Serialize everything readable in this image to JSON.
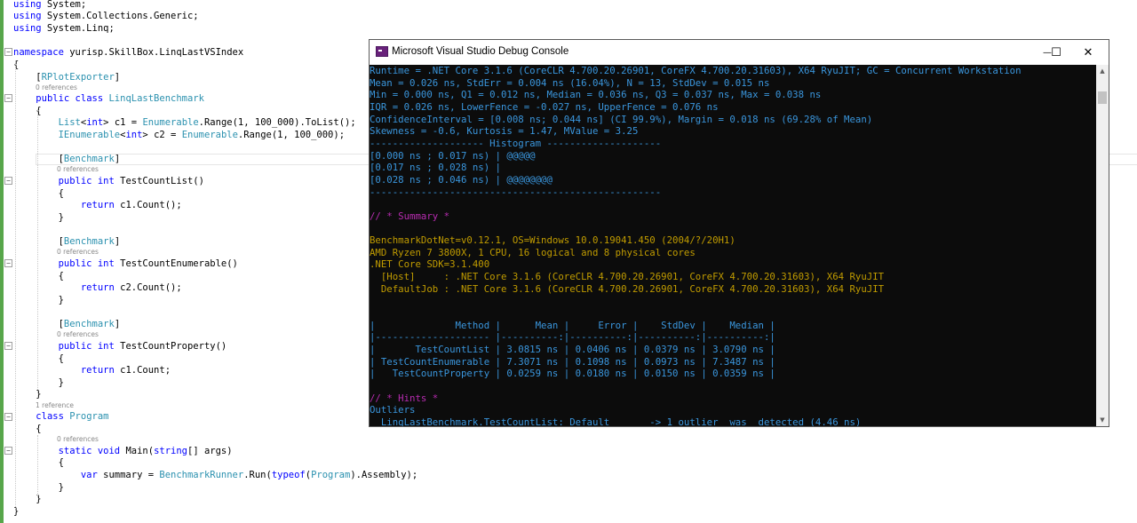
{
  "editor": {
    "lines": [
      {
        "parts": [
          [
            "kw",
            "using"
          ],
          [
            "tx",
            " System;"
          ]
        ]
      },
      {
        "parts": [
          [
            "kw",
            "using"
          ],
          [
            "tx",
            " System.Collections.Generic;"
          ]
        ]
      },
      {
        "parts": [
          [
            "kw",
            "using"
          ],
          [
            "tx",
            " System.Linq;"
          ]
        ]
      },
      {
        "parts": [
          [
            "tx",
            ""
          ]
        ]
      },
      {
        "parts": [
          [
            "kw",
            "namespace"
          ],
          [
            "tx",
            " yurisp.SkillBox.LinqLastVSIndex"
          ]
        ]
      },
      {
        "parts": [
          [
            "tx",
            "{"
          ]
        ]
      },
      {
        "parts": [
          [
            "tx",
            "    ["
          ],
          [
            "ty",
            "RPlotExporter"
          ],
          [
            "tx",
            "]"
          ]
        ]
      },
      {
        "parts": [
          [
            "tx",
            "    "
          ],
          [
            "kw",
            "public class"
          ],
          [
            "tx",
            " "
          ],
          [
            "ty",
            "LinqLastBenchmark"
          ]
        ]
      },
      {
        "parts": [
          [
            "tx",
            "    {"
          ]
        ]
      },
      {
        "parts": [
          [
            "tx",
            "        "
          ],
          [
            "ty",
            "List"
          ],
          [
            "tx",
            "<"
          ],
          [
            "kw",
            "int"
          ],
          [
            "tx",
            "> c1 = "
          ],
          [
            "ty",
            "Enumerable"
          ],
          [
            "tx",
            ".Range(1, 100_000).ToList();"
          ]
        ]
      },
      {
        "parts": [
          [
            "tx",
            "        "
          ],
          [
            "ty",
            "IEnumerable"
          ],
          [
            "tx",
            "<"
          ],
          [
            "kw",
            "int"
          ],
          [
            "tx",
            "> c2 = "
          ],
          [
            "ty",
            "Enumerable"
          ],
          [
            "tx",
            ".Range(1, 100_000);"
          ]
        ]
      },
      {
        "parts": [
          [
            "tx",
            ""
          ]
        ]
      },
      {
        "parts": [
          [
            "tx",
            "        ["
          ],
          [
            "ty",
            "Benchmark"
          ],
          [
            "tx",
            "]"
          ]
        ]
      },
      {
        "parts": [
          [
            "tx",
            "        "
          ],
          [
            "kw",
            "public int"
          ],
          [
            "tx",
            " TestCountList()"
          ]
        ]
      },
      {
        "parts": [
          [
            "tx",
            "        {"
          ]
        ]
      },
      {
        "parts": [
          [
            "tx",
            "            "
          ],
          [
            "kw",
            "return"
          ],
          [
            "tx",
            " c1.Count();"
          ]
        ]
      },
      {
        "parts": [
          [
            "tx",
            "        }"
          ]
        ]
      },
      {
        "parts": [
          [
            "tx",
            ""
          ]
        ]
      },
      {
        "parts": [
          [
            "tx",
            "        ["
          ],
          [
            "ty",
            "Benchmark"
          ],
          [
            "tx",
            "]"
          ]
        ]
      },
      {
        "parts": [
          [
            "tx",
            "        "
          ],
          [
            "kw",
            "public int"
          ],
          [
            "tx",
            " TestCountEnumerable()"
          ]
        ]
      },
      {
        "parts": [
          [
            "tx",
            "        {"
          ]
        ]
      },
      {
        "parts": [
          [
            "tx",
            "            "
          ],
          [
            "kw",
            "return"
          ],
          [
            "tx",
            " c2.Count();"
          ]
        ]
      },
      {
        "parts": [
          [
            "tx",
            "        }"
          ]
        ]
      },
      {
        "parts": [
          [
            "tx",
            ""
          ]
        ]
      },
      {
        "parts": [
          [
            "tx",
            "        ["
          ],
          [
            "ty",
            "Benchmark"
          ],
          [
            "tx",
            "]"
          ]
        ]
      },
      {
        "parts": [
          [
            "tx",
            "        "
          ],
          [
            "kw",
            "public int"
          ],
          [
            "tx",
            " TestCountProperty()"
          ]
        ]
      },
      {
        "parts": [
          [
            "tx",
            "        {"
          ]
        ]
      },
      {
        "parts": [
          [
            "tx",
            "            "
          ],
          [
            "kw",
            "return"
          ],
          [
            "tx",
            " c1.Count;"
          ]
        ]
      },
      {
        "parts": [
          [
            "tx",
            "        }"
          ]
        ]
      },
      {
        "parts": [
          [
            "tx",
            "    }"
          ]
        ]
      },
      {
        "parts": [
          [
            "tx",
            "    "
          ],
          [
            "kw",
            "class"
          ],
          [
            "tx",
            " "
          ],
          [
            "ty",
            "Program"
          ]
        ]
      },
      {
        "parts": [
          [
            "tx",
            "    {"
          ]
        ]
      },
      {
        "parts": [
          [
            "tx",
            "        "
          ],
          [
            "kw",
            "static void"
          ],
          [
            "tx",
            " Main("
          ],
          [
            "kw",
            "string"
          ],
          [
            "tx",
            "[] args)"
          ]
        ]
      },
      {
        "parts": [
          [
            "tx",
            "        {"
          ]
        ]
      },
      {
        "parts": [
          [
            "tx",
            "            "
          ],
          [
            "kw",
            "var"
          ],
          [
            "tx",
            " summary = "
          ],
          [
            "ty",
            "BenchmarkRunner"
          ],
          [
            "tx",
            ".Run("
          ],
          [
            "kw",
            "typeof"
          ],
          [
            "tx",
            "("
          ],
          [
            "ty",
            "Program"
          ],
          [
            "tx",
            ").Assembly);"
          ]
        ]
      },
      {
        "parts": [
          [
            "tx",
            "        }"
          ]
        ]
      },
      {
        "parts": [
          [
            "tx",
            "    }"
          ]
        ]
      },
      {
        "parts": [
          [
            "tx",
            "}"
          ]
        ]
      }
    ],
    "refs": {
      "zero": "0 references",
      "one": "1 reference"
    }
  },
  "console": {
    "title": "Microsoft Visual Studio Debug Console",
    "minimize": "—",
    "maximize": "☐",
    "close": "✕",
    "lines": [
      {
        "c": "cyan",
        "t": "Runtime = .NET Core 3.1.6 (CoreCLR 4.700.20.26901, CoreFX 4.700.20.31603), X64 RyuJIT; GC = Concurrent Workstation"
      },
      {
        "c": "cyan",
        "t": "Mean = 0.026 ns, StdErr = 0.004 ns (16.04%), N = 13, StdDev = 0.015 ns"
      },
      {
        "c": "cyan",
        "t": "Min = 0.000 ns, Q1 = 0.012 ns, Median = 0.036 ns, Q3 = 0.037 ns, Max = 0.038 ns"
      },
      {
        "c": "cyan",
        "t": "IQR = 0.026 ns, LowerFence = -0.027 ns, UpperFence = 0.076 ns"
      },
      {
        "c": "cyan",
        "t": "ConfidenceInterval = [0.008 ns; 0.044 ns] (CI 99.9%), Margin = 0.018 ns (69.28% of Mean)"
      },
      {
        "c": "cyan",
        "t": "Skewness = -0.6, Kurtosis = 1.47, MValue = 3.25"
      },
      {
        "c": "cyan",
        "t": "-------------------- Histogram --------------------"
      },
      {
        "c": "cyan",
        "t": "[0.000 ns ; 0.017 ns) | @@@@@"
      },
      {
        "c": "cyan",
        "t": "[0.017 ns ; 0.028 ns) |"
      },
      {
        "c": "cyan",
        "t": "[0.028 ns ; 0.046 ns) | @@@@@@@@"
      },
      {
        "c": "cyan",
        "t": "---------------------------------------------------"
      },
      {
        "c": "cyan",
        "t": ""
      },
      {
        "c": "magenta",
        "t": "// * Summary *"
      },
      {
        "c": "cyan",
        "t": ""
      },
      {
        "c": "yellow",
        "t": "BenchmarkDotNet=v0.12.1, OS=Windows 10.0.19041.450 (2004/?/20H1)"
      },
      {
        "c": "yellow",
        "t": "AMD Ryzen 7 3800X, 1 CPU, 16 logical and 8 physical cores"
      },
      {
        "c": "yellow",
        "t": ".NET Core SDK=3.1.400"
      },
      {
        "c": "yellow",
        "t": "  [Host]     : .NET Core 3.1.6 (CoreCLR 4.700.20.26901, CoreFX 4.700.20.31603), X64 RyuJIT"
      },
      {
        "c": "yellow",
        "t": "  DefaultJob : .NET Core 3.1.6 (CoreCLR 4.700.20.26901, CoreFX 4.700.20.31603), X64 RyuJIT"
      },
      {
        "c": "cyan",
        "t": ""
      },
      {
        "c": "cyan",
        "t": ""
      },
      {
        "c": "cyan",
        "t": "|              Method |      Mean |     Error |    StdDev |    Median |"
      },
      {
        "c": "cyan",
        "t": "|-------------------- |----------:|----------:|----------:|----------:|"
      },
      {
        "c": "cyan",
        "t": "|       TestCountList | 3.0815 ns | 0.0406 ns | 0.0379 ns | 3.0790 ns |"
      },
      {
        "c": "cyan",
        "t": "| TestCountEnumerable | 7.3071 ns | 0.1098 ns | 0.0973 ns | 7.3487 ns |"
      },
      {
        "c": "cyan",
        "t": "|   TestCountProperty | 0.0259 ns | 0.0180 ns | 0.0150 ns | 0.0359 ns |"
      },
      {
        "c": "cyan",
        "t": ""
      },
      {
        "c": "magenta",
        "t": "// * Hints *"
      },
      {
        "c": "cyan",
        "t": "Outliers"
      },
      {
        "c": "cyan",
        "t": "  LinqLastBenchmark.TestCountList: Default       -> 1 outlier  was  detected (4.46 ns)"
      }
    ]
  }
}
